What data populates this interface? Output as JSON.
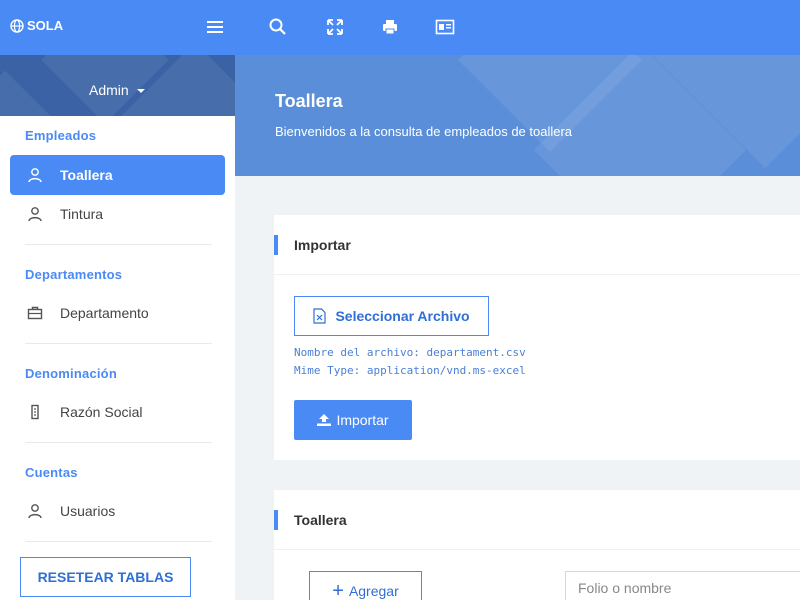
{
  "app": {
    "brand": "SOLA"
  },
  "topbar": {
    "icons": [
      "hamburger-menu-icon",
      "search-icon",
      "fullscreen-icon",
      "print-icon",
      "id-card-icon"
    ]
  },
  "sidebar": {
    "user": "Admin",
    "sections": [
      {
        "title": "Empleados",
        "items": [
          {
            "label": "Toallera",
            "icon": "user-icon",
            "active": true
          },
          {
            "label": "Tintura",
            "icon": "user-icon"
          }
        ]
      },
      {
        "title": "Departamentos",
        "items": [
          {
            "label": "Departamento",
            "icon": "briefcase-icon"
          }
        ]
      },
      {
        "title": "Denominación",
        "items": [
          {
            "label": "Razón Social",
            "icon": "document-icon"
          }
        ]
      },
      {
        "title": "Cuentas",
        "items": [
          {
            "label": "Usuarios",
            "icon": "user-icon"
          }
        ]
      }
    ],
    "reset_label": "RESETEAR TABLAS"
  },
  "banner": {
    "title": "Toallera",
    "subtitle": "Bienvenidos a la consulta de empleados de toallera"
  },
  "import_card": {
    "title": "Importar",
    "select_label": "Seleccionar Archivo",
    "file_name_line": "Nombre del archivo: departament.csv",
    "mime_line": "Mime Type: application/vnd.ms-excel",
    "import_label": "Importar"
  },
  "list_card": {
    "title": "Toallera",
    "add_label": "Agregar",
    "search_placeholder": "Folio o nombre"
  },
  "colors": {
    "primary": "#4a8af4",
    "sidebar_header": "#3a62a4",
    "banner": "#5b8ed8"
  }
}
